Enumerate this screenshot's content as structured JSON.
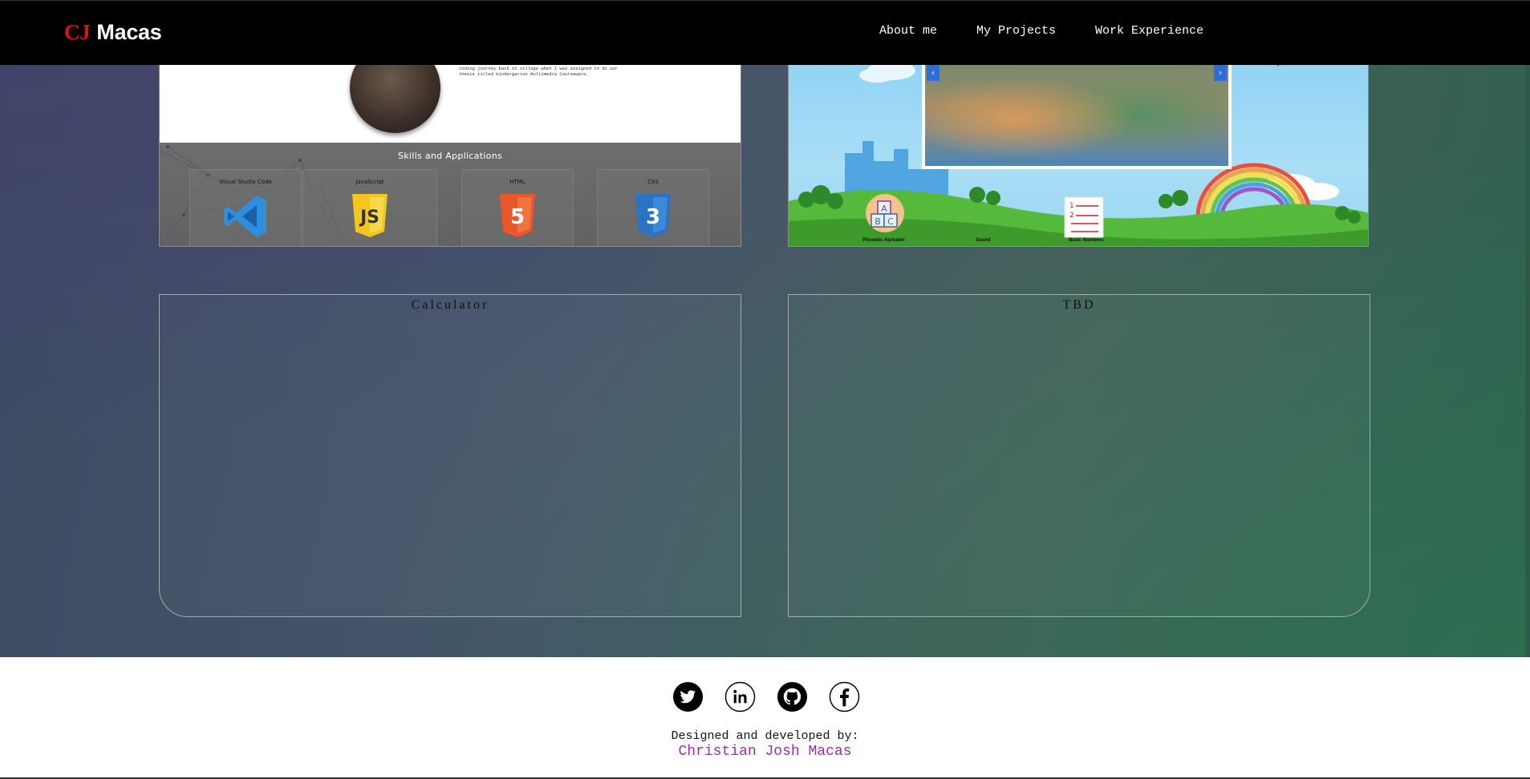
{
  "navbar": {
    "brand_first": "CJ",
    "brand_last": "Macas",
    "links": [
      "About me",
      "My Projects",
      "Work Experience"
    ]
  },
  "about": {
    "intro_text": "coding journey back in college when I was assigned to do our thesis titled Kindergarten Multimedia Courseware.",
    "skills_title": "Skills and Applications",
    "skills": [
      {
        "label": "Visual Studio Code",
        "icon": "vscode-icon",
        "color": "#2f8fdd"
      },
      {
        "label": "JavaScript",
        "icon": "javascript-icon",
        "color": "#f2c61d"
      },
      {
        "label": "HTML",
        "icon": "html5-icon",
        "color": "#e8562a"
      },
      {
        "label": "CSS",
        "icon": "css3-icon",
        "color": "#2b73c3"
      }
    ]
  },
  "kinder": {
    "carousel_prev": "‹",
    "carousel_next": "›",
    "labels": [
      "Phonetic Alphabet",
      "Sound",
      "Basic Numbers"
    ]
  },
  "projects": {
    "calculator_title": "Calculator",
    "tbd_title": "TBD"
  },
  "footer": {
    "socials": [
      "twitter-icon",
      "linkedin-icon",
      "github-icon",
      "facebook-icon"
    ],
    "credit": "Designed and developed by:",
    "author": "Christian Josh Macas"
  },
  "colors": {
    "brand_accent": "#e0101a",
    "author_link": "#9a2fa4",
    "navbar": "#000000"
  }
}
